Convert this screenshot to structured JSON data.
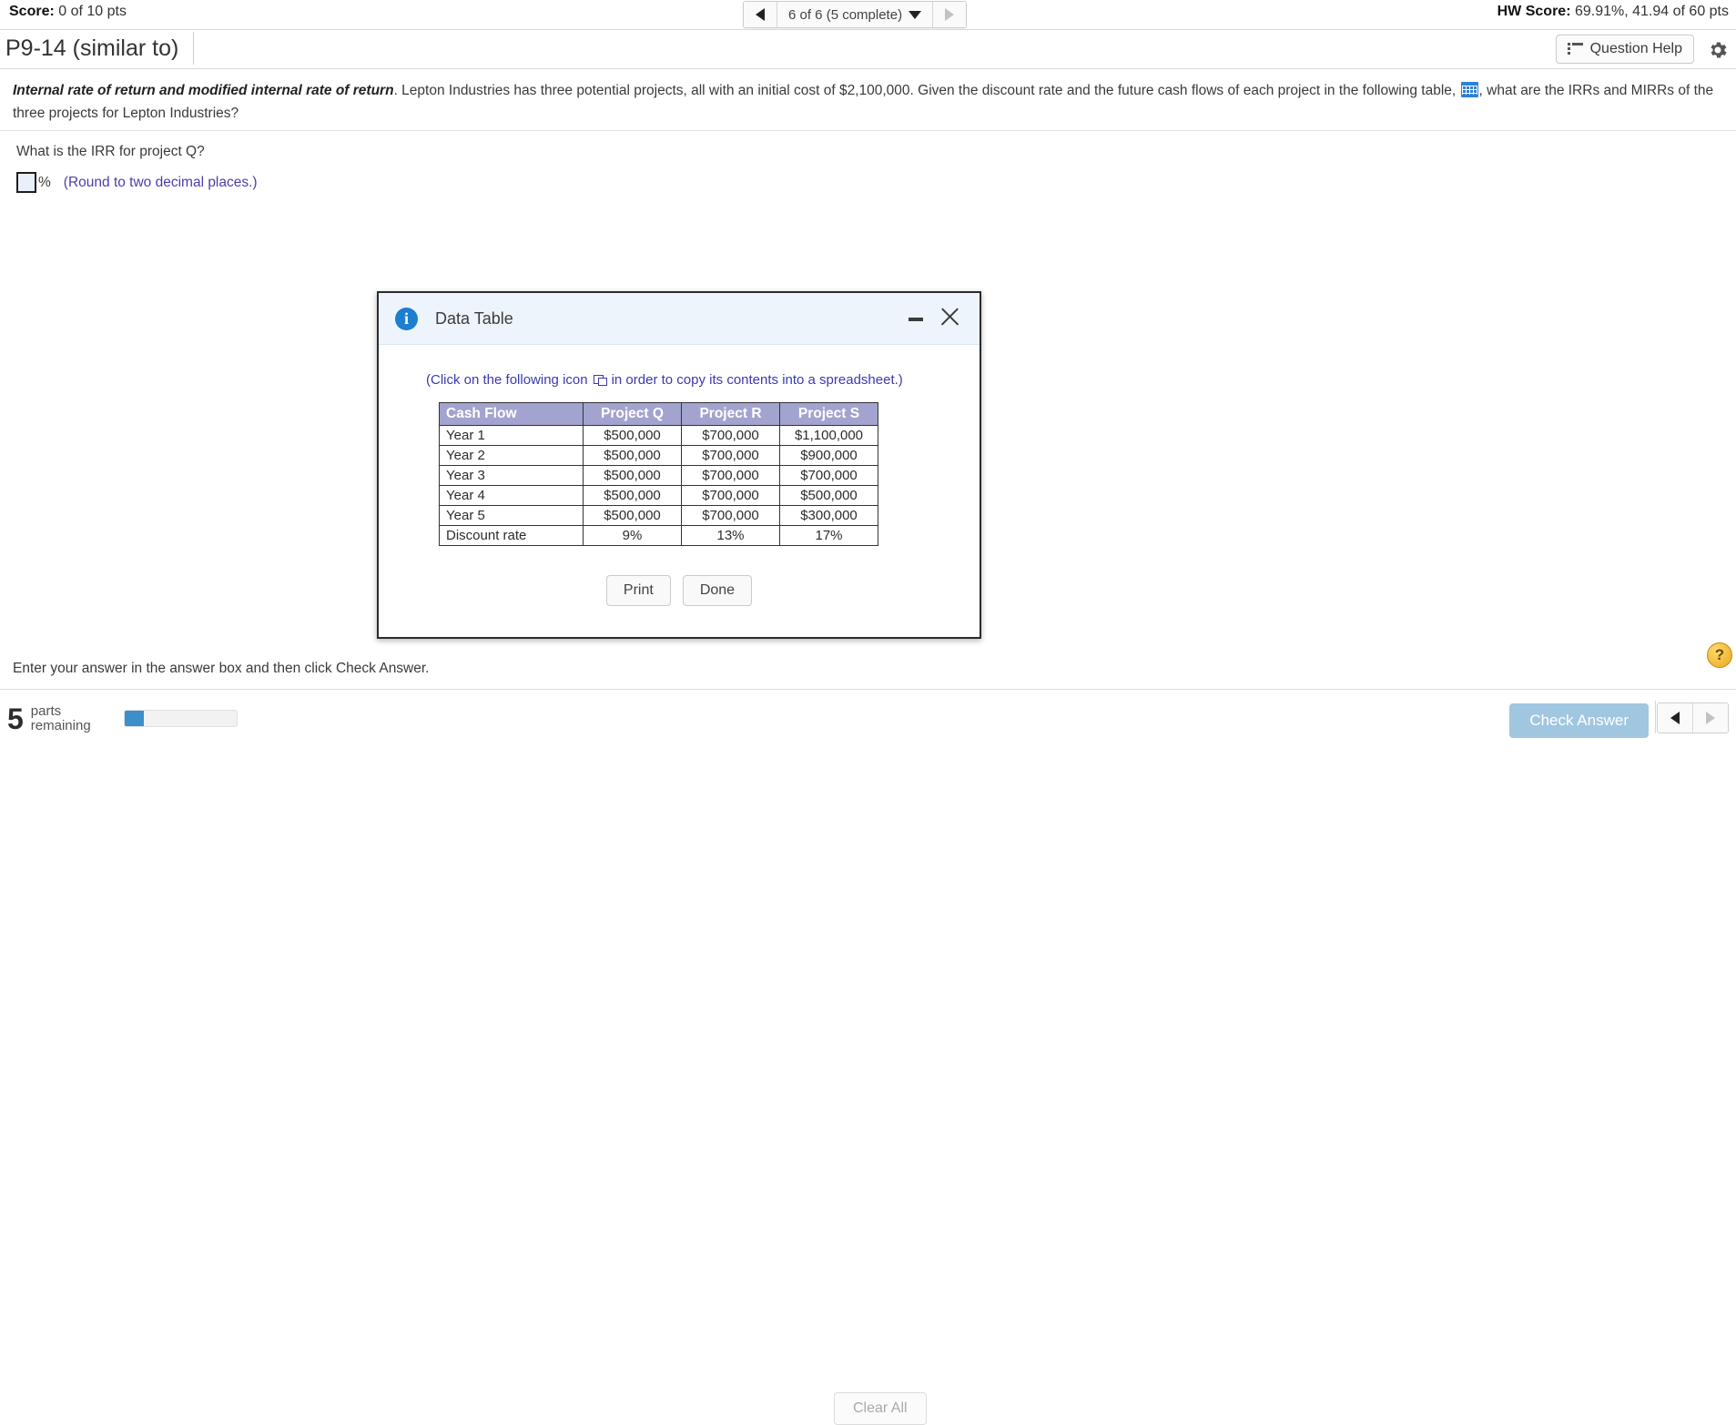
{
  "topbar": {
    "score_label": "Score:",
    "score_value": "0 of 10 pts",
    "hw_label": "HW Score:",
    "hw_value": "69.91%, 41.94 of 60 pts",
    "nav": {
      "prev_icon": "triangle-left-icon",
      "position": "6 of 6 (5 complete)",
      "dropdown_icon": "triangle-down-icon",
      "next_icon": "triangle-right-icon"
    }
  },
  "titlebar": {
    "question_id": "P9-14 (similar to)",
    "question_help": "Question Help",
    "help_icon": "list-icon",
    "settings_icon": "gear-icon"
  },
  "problem": {
    "lead": "Internal rate of return and modified internal rate of return",
    "text_1": ". Lepton Industries has three potential projects, all with an initial cost of $2,100,000. Given the discount rate and the future cash flows of each project in the following table,",
    "table_icon": "data-table-icon",
    "text_2": ", what are the IRRs and MIRRs of the three projects for Lepton Industries?"
  },
  "part": {
    "question": "What is the IRR for project Q?",
    "input_value": "",
    "input_placeholder": "",
    "percent_symbol": "%",
    "rounding_hint": "(Round to two decimal places.)"
  },
  "modal": {
    "title": "Data Table",
    "info_icon": "info-icon",
    "minimize_icon": "minimize-icon",
    "close_icon": "close-icon",
    "copy_note_before": "(Click on the following icon",
    "copy_icon": "copy-to-spreadsheet-icon",
    "copy_note_after": "in order to copy its contents into a spreadsheet.)",
    "print_label": "Print",
    "done_label": "Done"
  },
  "table": {
    "headers": [
      "Cash Flow",
      "Project Q",
      "Project R",
      "Project S"
    ],
    "rows": [
      {
        "label": "Year 1",
        "q": "$500,000",
        "r": "$700,000",
        "s": "$1,100,000"
      },
      {
        "label": "Year 2",
        "q": "$500,000",
        "r": "$700,000",
        "s": "$900,000"
      },
      {
        "label": "Year 3",
        "q": "$500,000",
        "r": "$700,000",
        "s": "$700,000"
      },
      {
        "label": "Year 4",
        "q": "$500,000",
        "r": "$700,000",
        "s": "$500,000"
      },
      {
        "label": "Year 5",
        "q": "$500,000",
        "r": "$700,000",
        "s": "$300,000"
      },
      {
        "label": "Discount rate",
        "q": "9%",
        "r": "13%",
        "s": "17%"
      }
    ]
  },
  "footer": {
    "instruction": "Enter your answer in the answer box and then click Check Answer.",
    "help_bubble": "?",
    "parts_count": "5",
    "parts_label_line1": "parts",
    "parts_label_line2": "remaining",
    "progress_percent": 17,
    "clear_all": "Clear All",
    "check_answer": "Check Answer",
    "prev_icon": "triangle-left-icon",
    "next_icon": "triangle-right-icon"
  },
  "colors": {
    "table_header_bg": "#a3a3cf",
    "accent_blue": "#3d8fca",
    "hint_purple": "#4b3fa8",
    "disabled_button": "#a0c6e0"
  }
}
